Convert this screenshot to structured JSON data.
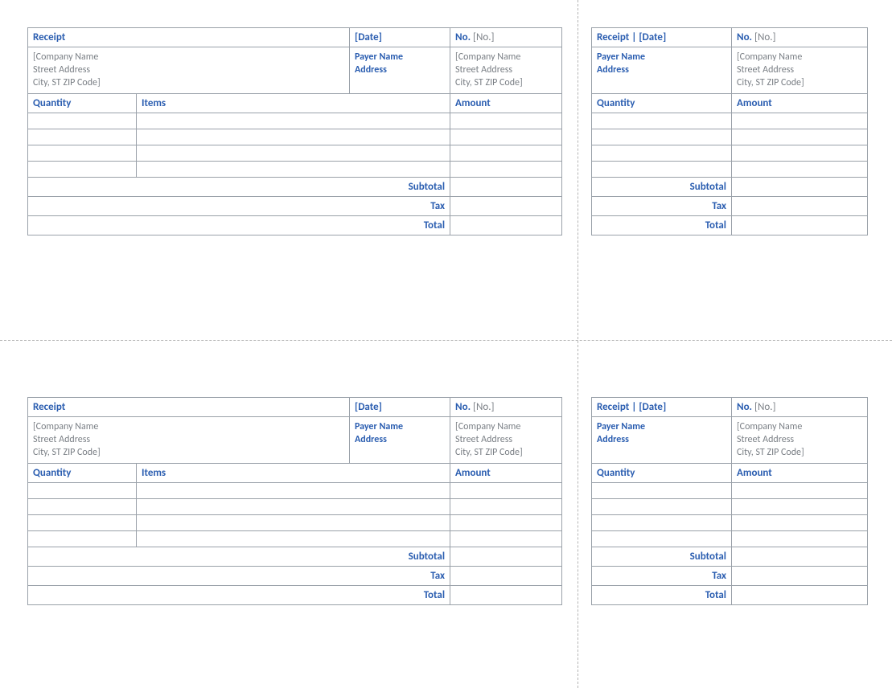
{
  "labels": {
    "receipt": "Receipt",
    "date": "[Date]",
    "no": "No.",
    "no_val": "[No.]",
    "payer_name": "Payer Name",
    "address": "Address",
    "quantity": "Quantity",
    "items": "Items",
    "amount": "Amount",
    "subtotal": "Subtotal",
    "tax": "Tax",
    "total": "Total",
    "receipt_date_stub": "Receipt | [Date]"
  },
  "company": {
    "line1": "[Company Name",
    "line2": "Street Address",
    "line3": "City, ST ZIP Code]"
  }
}
